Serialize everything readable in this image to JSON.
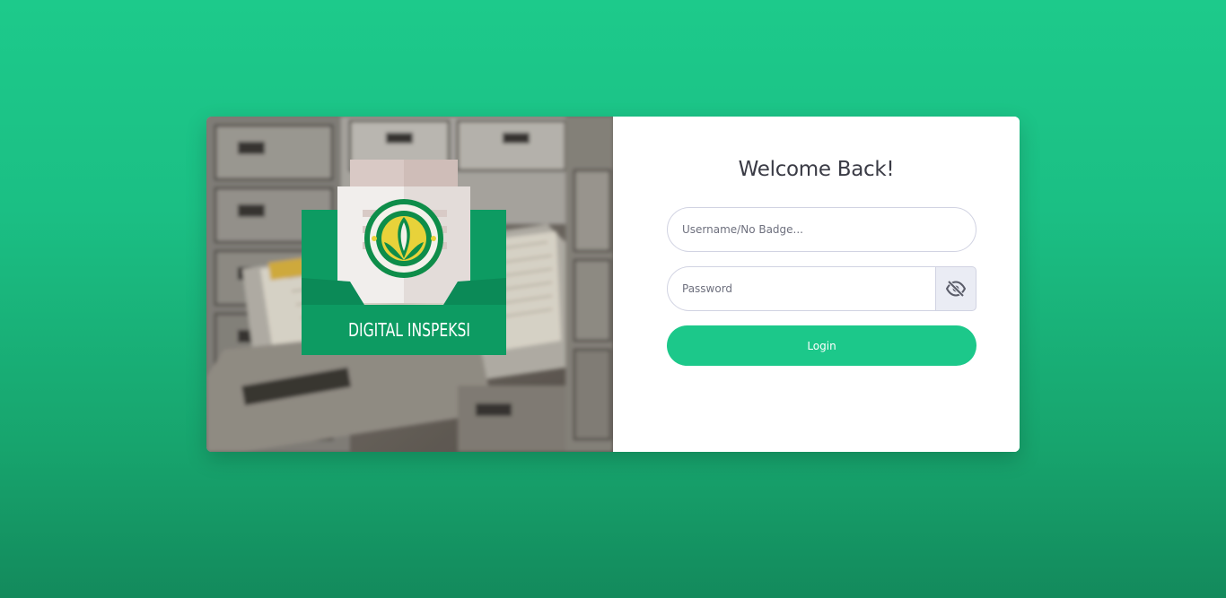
{
  "hero": {
    "logo_title": "DIGITAL INSPEKSI",
    "emblem_text": "PUPUK KUJANG CIKAMPEK"
  },
  "form": {
    "heading": "Welcome Back!",
    "username_placeholder": "Username/No Badge...",
    "password_placeholder": "Password",
    "login_label": "Login",
    "password_toggle_icon": "eye-slash-icon"
  },
  "colors": {
    "background_top": "#1dca8b",
    "background_bottom": "#138a5c",
    "primary": "#1cc88a",
    "logo_green": "#0d9b62"
  }
}
